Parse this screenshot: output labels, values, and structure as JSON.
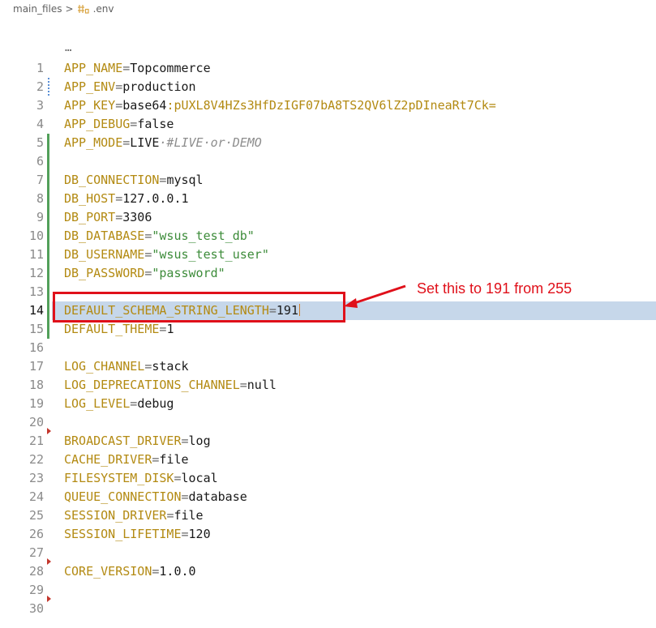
{
  "breadcrumb": {
    "folder": "main_files",
    "separator": ">",
    "file": ".env"
  },
  "editor": {
    "folded_indicator": "…",
    "active_line": 14,
    "lines": [
      {
        "num": "1",
        "key": "APP_NAME",
        "op": "=",
        "val": "Topcommerce",
        "val_type": "plain",
        "marker": ""
      },
      {
        "num": "2",
        "key": "APP_ENV",
        "op": "=",
        "val": "production",
        "val_type": "plain",
        "marker": "modified"
      },
      {
        "num": "3",
        "key": "APP_KEY",
        "op": "=",
        "val": "base64",
        "val_type": "plain",
        "extra": ":pUXL8V4HZs3HfDzIGF07bA8TS2QV6lZ2pDIneaRt7Ck=",
        "marker": ""
      },
      {
        "num": "4",
        "key": "APP_DEBUG",
        "op": "=",
        "val": "false",
        "val_type": "plain",
        "marker": ""
      },
      {
        "num": "5",
        "key": "APP_MODE",
        "op": "=",
        "val": "LIVE",
        "val_type": "plain",
        "comment": "·#LIVE·or·DEMO",
        "marker": "added"
      },
      {
        "num": "6",
        "key": "",
        "op": "",
        "val": "",
        "val_type": "plain",
        "marker": "added"
      },
      {
        "num": "7",
        "key": "DB_CONNECTION",
        "op": "=",
        "val": "mysql",
        "val_type": "plain",
        "marker": "added"
      },
      {
        "num": "8",
        "key": "DB_HOST",
        "op": "=",
        "val": "127.0.0.1",
        "val_type": "plain",
        "marker": "added"
      },
      {
        "num": "9",
        "key": "DB_PORT",
        "op": "=",
        "val": "3306",
        "val_type": "plain",
        "marker": "added"
      },
      {
        "num": "10",
        "key": "DB_DATABASE",
        "op": "=",
        "val": "\"wsus_test_db\"",
        "val_type": "string",
        "marker": "added"
      },
      {
        "num": "11",
        "key": "DB_USERNAME",
        "op": "=",
        "val": "\"wsus_test_user\"",
        "val_type": "string",
        "marker": "added"
      },
      {
        "num": "12",
        "key": "DB_PASSWORD",
        "op": "=",
        "val": "\"password\"",
        "val_type": "string",
        "marker": "added"
      },
      {
        "num": "13",
        "key": "",
        "op": "",
        "val": "",
        "val_type": "plain",
        "marker": "added"
      },
      {
        "num": "14",
        "key": "DEFAULT_SCHEMA_STRING_LENGTH",
        "op": "=",
        "val": "191",
        "val_type": "plain",
        "marker": "added"
      },
      {
        "num": "15",
        "key": "DEFAULT_THEME",
        "op": "=",
        "val": "1",
        "val_type": "plain",
        "marker": "added"
      },
      {
        "num": "16",
        "key": "",
        "op": "",
        "val": "",
        "val_type": "plain",
        "marker": ""
      },
      {
        "num": "17",
        "key": "LOG_CHANNEL",
        "op": "=",
        "val": "stack",
        "val_type": "plain",
        "marker": ""
      },
      {
        "num": "18",
        "key": "LOG_DEPRECATIONS_CHANNEL",
        "op": "=",
        "val": "null",
        "val_type": "plain",
        "marker": ""
      },
      {
        "num": "19",
        "key": "LOG_LEVEL",
        "op": "=",
        "val": "debug",
        "val_type": "plain",
        "marker": ""
      },
      {
        "num": "20",
        "key": "",
        "op": "",
        "val": "",
        "val_type": "plain",
        "marker": "deleted"
      },
      {
        "num": "21",
        "key": "BROADCAST_DRIVER",
        "op": "=",
        "val": "log",
        "val_type": "plain",
        "marker": ""
      },
      {
        "num": "22",
        "key": "CACHE_DRIVER",
        "op": "=",
        "val": "file",
        "val_type": "plain",
        "marker": ""
      },
      {
        "num": "23",
        "key": "FILESYSTEM_DISK",
        "op": "=",
        "val": "local",
        "val_type": "plain",
        "marker": ""
      },
      {
        "num": "24",
        "key": "QUEUE_CONNECTION",
        "op": "=",
        "val": "database",
        "val_type": "plain",
        "marker": ""
      },
      {
        "num": "25",
        "key": "SESSION_DRIVER",
        "op": "=",
        "val": "file",
        "val_type": "plain",
        "marker": ""
      },
      {
        "num": "26",
        "key": "SESSION_LIFETIME",
        "op": "=",
        "val": "120",
        "val_type": "plain",
        "marker": ""
      },
      {
        "num": "27",
        "key": "",
        "op": "",
        "val": "",
        "val_type": "plain",
        "marker": "deleted"
      },
      {
        "num": "28",
        "key": "CORE_VERSION",
        "op": "=",
        "val": "1.0.0",
        "val_type": "plain",
        "marker": ""
      },
      {
        "num": "29",
        "key": "",
        "op": "",
        "val": "",
        "val_type": "plain",
        "marker": "deleted"
      },
      {
        "num": "30",
        "key": "",
        "op": "",
        "val": "",
        "val_type": "plain",
        "marker": ""
      }
    ]
  },
  "annotation": {
    "text": "Set this to 191 from 255",
    "color": "#e0101a"
  },
  "colors": {
    "key": "#b38a12",
    "string": "#3d8c3a",
    "comment": "#8d8d8d",
    "line_highlight": "#c6d7ea",
    "added_marker": "#52a05a",
    "modified_marker": "#5a8fd6",
    "deleted_marker": "#c4362c"
  }
}
